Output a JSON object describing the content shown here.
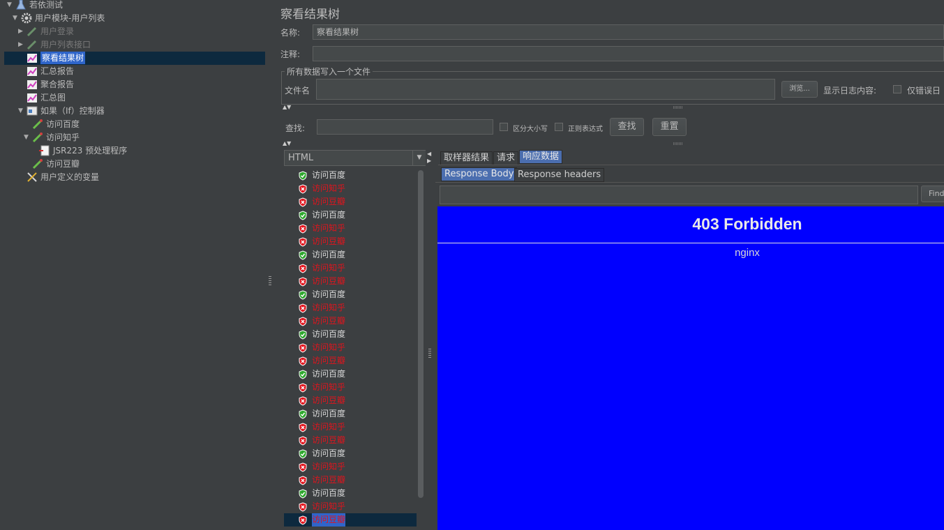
{
  "tree": {
    "root": "若依测试",
    "module": "用户模块-用户列表",
    "items": [
      {
        "label": "用户登录"
      },
      {
        "label": "用户列表接口"
      },
      {
        "label": "察看结果树"
      },
      {
        "label": "汇总报告"
      },
      {
        "label": "聚合报告"
      },
      {
        "label": "汇总图"
      },
      {
        "label": "如果（If）控制器"
      },
      {
        "label": "访问百度"
      },
      {
        "label": "访问知乎"
      },
      {
        "label": "JSR223 预处理程序"
      },
      {
        "label": "访问豆瓣"
      },
      {
        "label": "用户定义的变量"
      }
    ]
  },
  "panel": {
    "title": "察看结果树",
    "name_label": "名称:",
    "name_value": "察看结果树",
    "comment_label": "注释:",
    "comment_value": "",
    "file_group": "所有数据写入一个文件",
    "file_label": "文件名",
    "file_value": "",
    "browse": "浏览...",
    "log_label": "显示日志内容:",
    "errors_only": "仅错误日"
  },
  "search": {
    "label": "查找:",
    "value": "",
    "case": "区分大小写",
    "regex": "正则表达式",
    "find": "查找",
    "reset": "重置"
  },
  "renderer": "HTML",
  "results": [
    {
      "label": "访问百度",
      "status": "ok"
    },
    {
      "label": "访问知乎",
      "status": "err"
    },
    {
      "label": "访问豆瓣",
      "status": "err"
    },
    {
      "label": "访问百度",
      "status": "ok"
    },
    {
      "label": "访问知乎",
      "status": "err"
    },
    {
      "label": "访问豆瓣",
      "status": "err"
    },
    {
      "label": "访问百度",
      "status": "ok"
    },
    {
      "label": "访问知乎",
      "status": "err"
    },
    {
      "label": "访问豆瓣",
      "status": "err"
    },
    {
      "label": "访问百度",
      "status": "ok"
    },
    {
      "label": "访问知乎",
      "status": "err"
    },
    {
      "label": "访问豆瓣",
      "status": "err"
    },
    {
      "label": "访问百度",
      "status": "ok"
    },
    {
      "label": "访问知乎",
      "status": "err"
    },
    {
      "label": "访问豆瓣",
      "status": "err"
    },
    {
      "label": "访问百度",
      "status": "ok"
    },
    {
      "label": "访问知乎",
      "status": "err"
    },
    {
      "label": "访问豆瓣",
      "status": "err"
    },
    {
      "label": "访问百度",
      "status": "ok"
    },
    {
      "label": "访问知乎",
      "status": "err"
    },
    {
      "label": "访问豆瓣",
      "status": "err"
    },
    {
      "label": "访问百度",
      "status": "ok"
    },
    {
      "label": "访问知乎",
      "status": "err"
    },
    {
      "label": "访问豆瓣",
      "status": "err"
    },
    {
      "label": "访问百度",
      "status": "ok"
    },
    {
      "label": "访问知乎",
      "status": "err"
    },
    {
      "label": "访问豆瓣",
      "status": "err",
      "selected": true
    }
  ],
  "tabs": {
    "sampler_result": "取样器结果",
    "request": "请求",
    "response_data": "响应数据",
    "response_body": "Response Body",
    "response_headers": "Response headers",
    "find": "Find"
  },
  "response": {
    "heading": "403 Forbidden",
    "server": "nginx"
  },
  "colors": {
    "ok": "#2ea82e",
    "err": "#e0141d",
    "render_bg": "#0000ff",
    "selection": "#2f65ca"
  }
}
